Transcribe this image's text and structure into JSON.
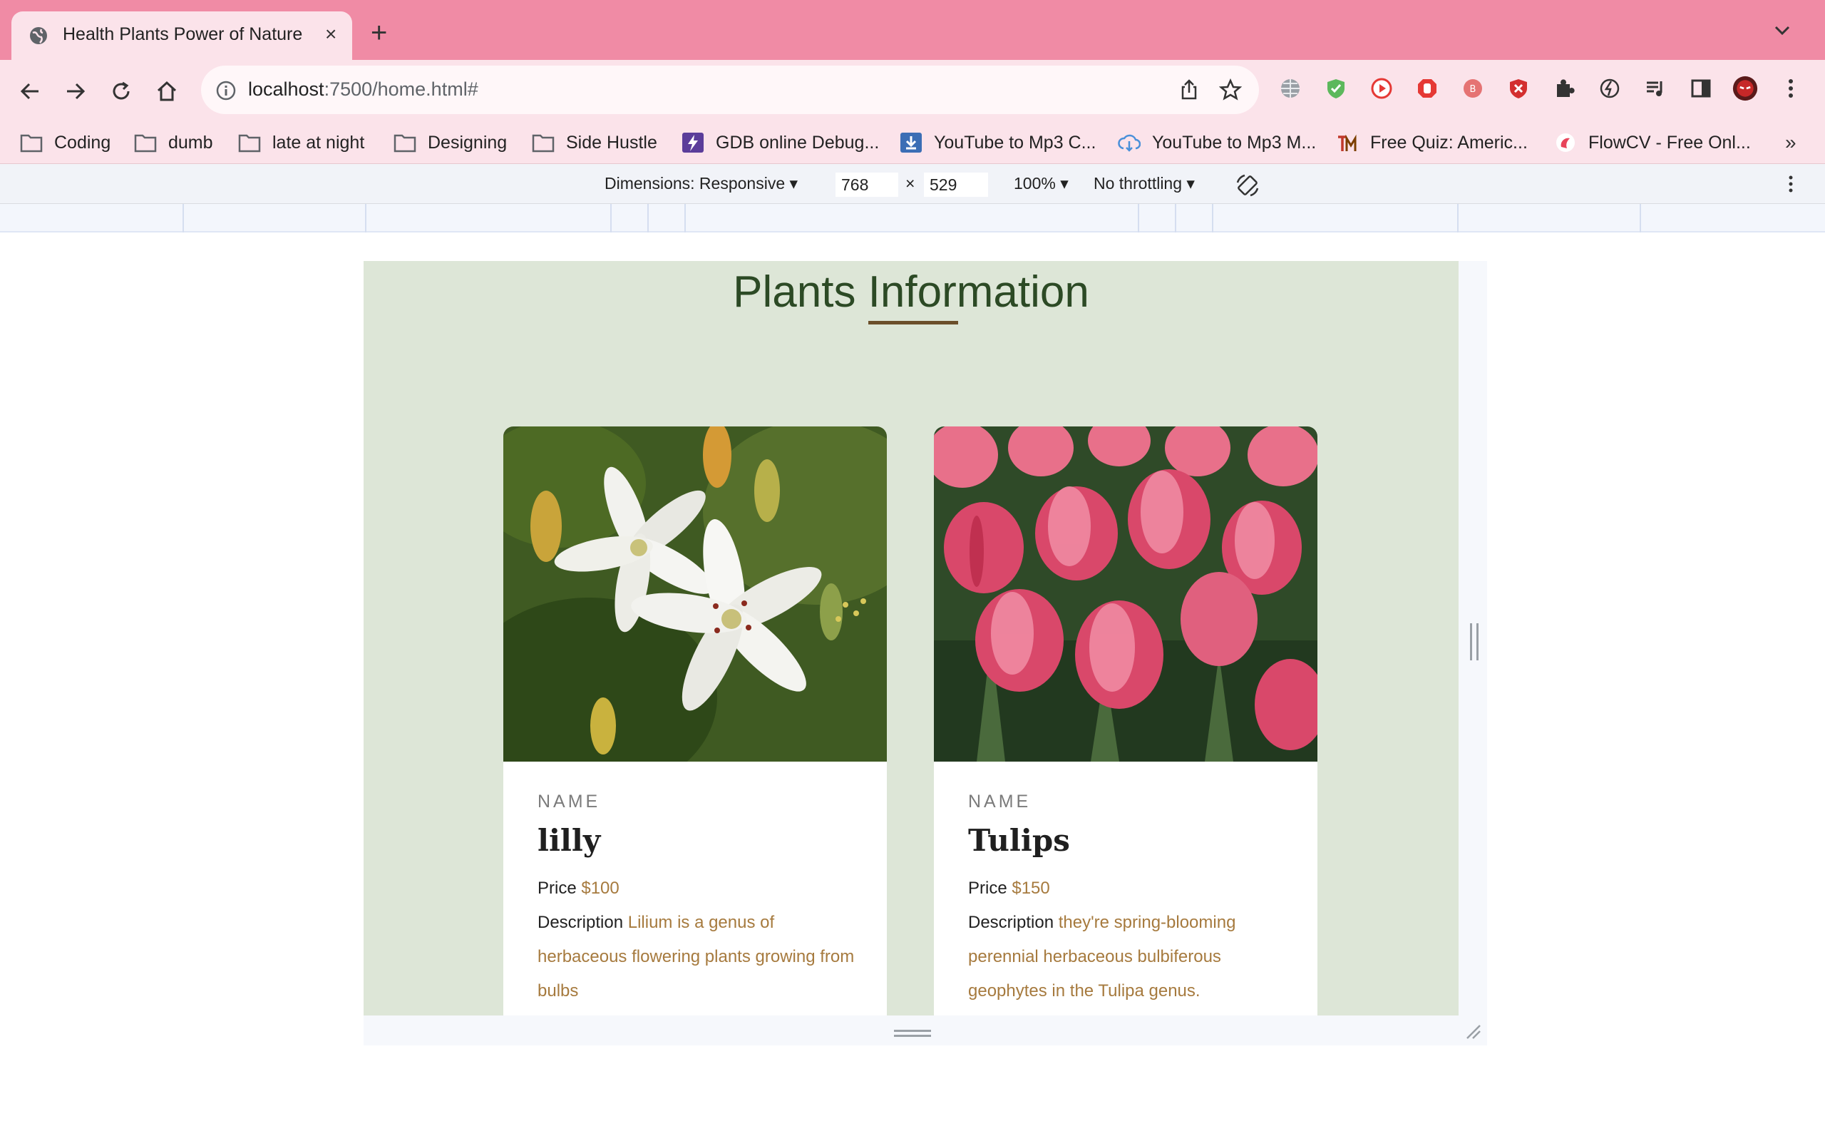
{
  "browser": {
    "tab_title": "Health Plants Power of Nature",
    "tab_close": "×",
    "new_tab": "+",
    "url_host": "localhost",
    "url_path": ":7500/home.html#",
    "bookmarks": [
      {
        "label": "Coding",
        "icon": "folder-icon"
      },
      {
        "label": "dumb",
        "icon": "folder-icon"
      },
      {
        "label": "late at night",
        "icon": "folder-icon"
      },
      {
        "label": "Designing",
        "icon": "folder-icon"
      },
      {
        "label": "Side Hustle",
        "icon": "folder-icon"
      },
      {
        "label": "GDB online Debug...",
        "icon": "gdb-icon"
      },
      {
        "label": "YouTube to Mp3 C...",
        "icon": "download-icon"
      },
      {
        "label": "YouTube to Mp3 M...",
        "icon": "cloud-download-icon"
      },
      {
        "label": "Free Quiz: Americ...",
        "icon": "quiz-icon"
      },
      {
        "label": "FlowCV - Free Onl...",
        "icon": "flowcv-icon"
      }
    ],
    "bookmarks_more": "»"
  },
  "devtools": {
    "dimensions_label": "Dimensions: Responsive",
    "width": "768",
    "times": "×",
    "height": "529",
    "zoom": "100%",
    "throttling": "No throttling"
  },
  "page": {
    "heading": "Plants Information",
    "cards": [
      {
        "label": "NAME",
        "name": "lilly",
        "price_label": "Price",
        "price": "$100",
        "description_label": "Description",
        "description": "Lilium is a genus of herbaceous flowering plants growing from bulbs",
        "image": "white lily flowers"
      },
      {
        "label": "NAME",
        "name": "Tulips",
        "price_label": "Price",
        "price": "$150",
        "description_label": "Description",
        "description": "they're spring-blooming perennial herbaceous bulbiferous geophytes in the Tulipa genus.",
        "image": "pink tulip flowers"
      }
    ]
  },
  "colors": {
    "tab_strip": "#f08ba5",
    "toolbar": "#fbe3ea",
    "page_bg": "#dde6d7",
    "heading": "#2c4a25",
    "accent": "#a67a3e"
  }
}
